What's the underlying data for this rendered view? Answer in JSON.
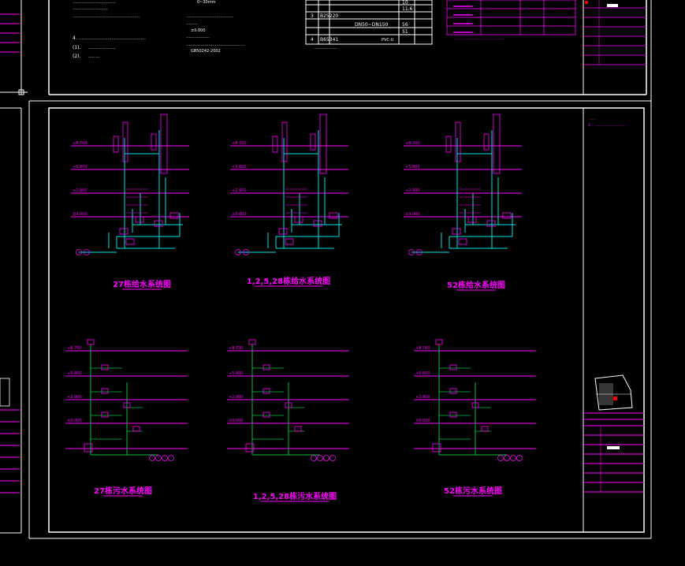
{
  "colors": {
    "background": "#000000",
    "frame": "#ffffff",
    "supply_pipe": "#00e5e5",
    "drain_pipe": "#00c040",
    "annotation": "#ff00ff",
    "text_white": "#ffffff",
    "marker_red": "#ff0000"
  },
  "top_notes": {
    "item_4": "4.",
    "item_4_sub1": "(1).",
    "item_4_sub2": "(2).",
    "note_dim": "0~30mm",
    "elevation": "±0.000",
    "standard_code": "GB50242-2002"
  },
  "equipment_table": {
    "rows": [
      {
        "no": "",
        "code": "",
        "qty": "10"
      },
      {
        "no": "",
        "code": "",
        "qty": "11.6"
      },
      {
        "no": "3",
        "code": "B25220",
        "qty": ""
      },
      {
        "no": "",
        "code": "DN50~DN150",
        "qty": "56"
      },
      {
        "no": "",
        "code": "",
        "qty": "51"
      },
      {
        "no": "4",
        "code": "B65341",
        "qty": "PVC-U"
      }
    ]
  },
  "legend_table": {
    "rows": [
      "",
      "",
      "",
      ""
    ]
  },
  "title_block_top": {
    "rows": [
      "",
      "",
      "",
      "",
      ""
    ]
  },
  "notes_right": {
    "line1": "1."
  },
  "diagrams": [
    {
      "title": "27栋给水系统图",
      "kind": "supply"
    },
    {
      "title": "1,2,5,28栋给水系统图",
      "kind": "supply"
    },
    {
      "title": "52栋给水系统图",
      "kind": "supply"
    },
    {
      "title": "27栋污水系统图",
      "kind": "drain"
    },
    {
      "title": "1,2,5,28栋污水系统图",
      "kind": "drain"
    },
    {
      "title": "52栋污水系统图",
      "kind": "drain"
    }
  ],
  "floor_levels": [
    "+8.700",
    "+5.800",
    "+2.900",
    "±0.000"
  ]
}
